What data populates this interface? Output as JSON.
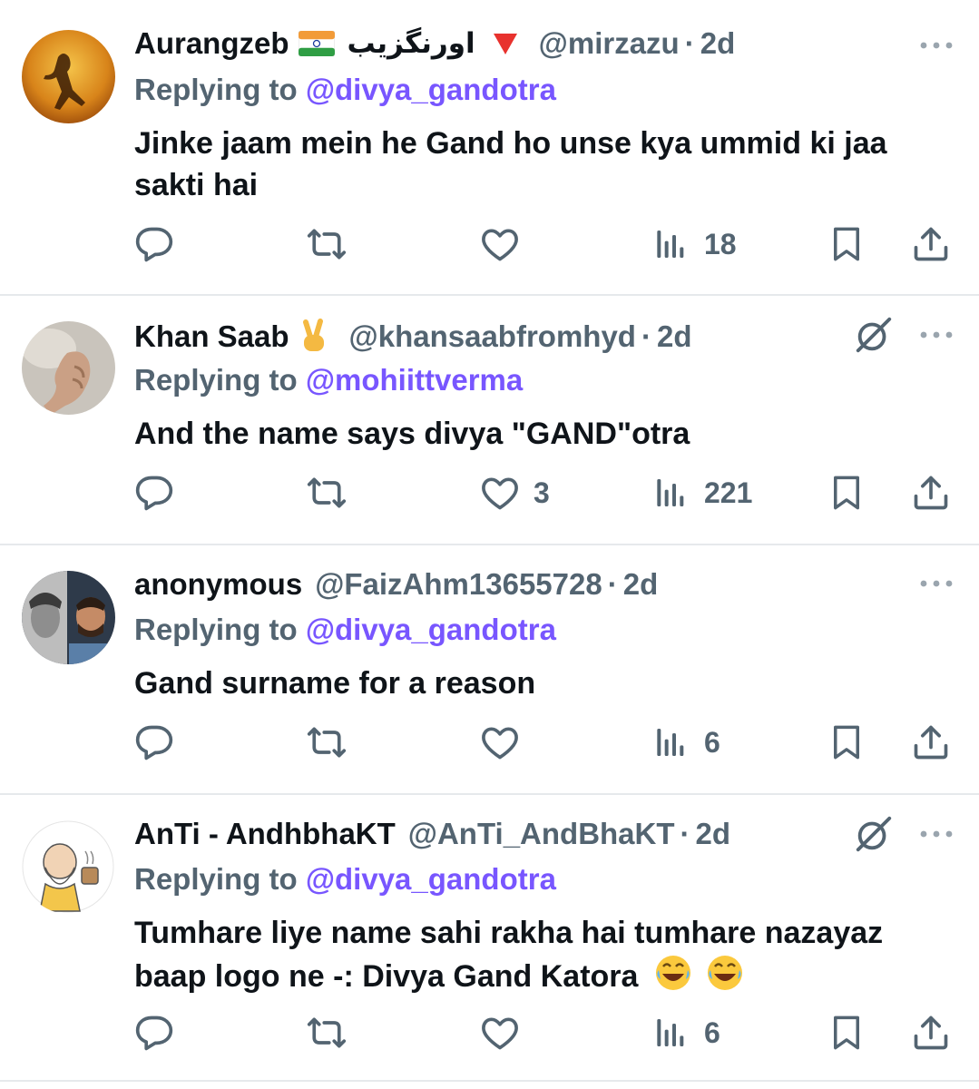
{
  "tweets": [
    {
      "name": "Aurangzeb",
      "urdu_name": "اورنگزیب",
      "handle": "@mirzazu",
      "time": "2d",
      "replying_prefix": "Replying to",
      "replying_to": "@divya_gandotra",
      "text": "Jinke jaam mein he Gand ho unse kya ummid ki jaa sakti hai",
      "reply_count": "",
      "retweet_count": "",
      "like_count": "",
      "view_count": "18"
    },
    {
      "name": "Khan Saab",
      "handle": "@khansaabfromhyd",
      "time": "2d",
      "replying_prefix": "Replying to",
      "replying_to": "@mohiittverma",
      "text": "And the name says  divya \"GAND\"otra",
      "reply_count": "",
      "retweet_count": "",
      "like_count": "3",
      "view_count": "221"
    },
    {
      "name": "anonymous",
      "handle": "@FaizAhm13655728",
      "time": "2d",
      "replying_prefix": "Replying to",
      "replying_to": "@divya_gandotra",
      "text": "Gand surname for a reason",
      "reply_count": "",
      "retweet_count": "",
      "like_count": "",
      "view_count": "6"
    },
    {
      "name": "AnTi - AndhbhaKT",
      "handle": "@AnTi_AndBhaKT",
      "time": "2d",
      "replying_prefix": "Replying to",
      "replying_to": "@divya_gandotra",
      "text": "Tumhare liye name sahi rakha hai tumhare nazayaz baap logo ne -: Divya Gand Katora",
      "reply_count": "",
      "retweet_count": "",
      "like_count": "",
      "view_count": "6"
    }
  ],
  "colors": {
    "secondary_text": "#536471",
    "mention": "#7856ff",
    "divider": "#e6e9ec",
    "primary_text": "#0f1419"
  },
  "icons": [
    "reply-icon",
    "retweet-icon",
    "like-icon",
    "views-icon",
    "bookmark-icon",
    "share-icon",
    "more-icon",
    "grok-icon",
    "india-flag-icon",
    "red-triangle-icon",
    "victory-hand-icon",
    "laughing-emoji-icon"
  ]
}
